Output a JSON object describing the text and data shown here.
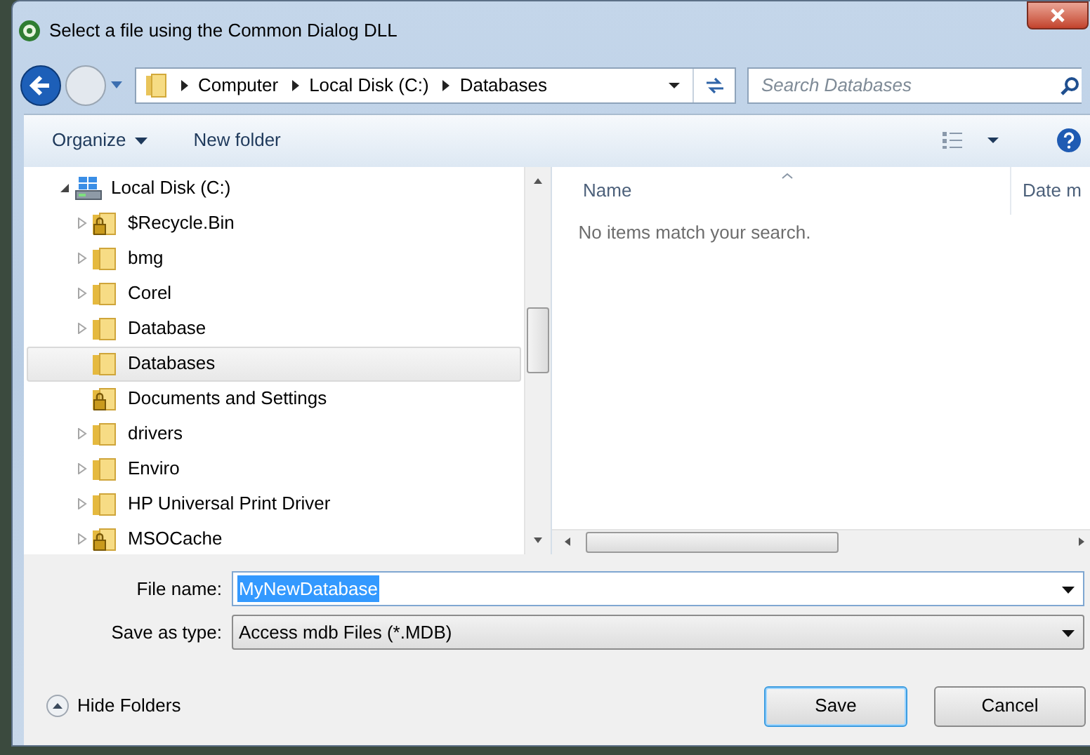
{
  "window": {
    "title": "Select a file using the Common Dialog DLL"
  },
  "address": {
    "breadcrumb": [
      "Computer",
      "Local Disk (C:)",
      "Databases"
    ]
  },
  "search": {
    "placeholder": "Search Databases"
  },
  "toolbar": {
    "organize": "Organize",
    "new_folder": "New folder"
  },
  "tree": [
    {
      "label": "Local Disk (C:)",
      "kind": "drive",
      "expanded": true,
      "selected": false,
      "children": [
        {
          "label": "$Recycle.Bin",
          "kind": "locked-folder",
          "expanded": false,
          "selected": false
        },
        {
          "label": "bmg",
          "kind": "folder",
          "expanded": false,
          "selected": false
        },
        {
          "label": "Corel",
          "kind": "folder",
          "expanded": false,
          "selected": false
        },
        {
          "label": "Database",
          "kind": "folder",
          "expanded": false,
          "selected": false
        },
        {
          "label": "Databases",
          "kind": "folder",
          "selected": true
        },
        {
          "label": "Documents and Settings",
          "kind": "locked-folder",
          "selected": false
        },
        {
          "label": "drivers",
          "kind": "folder",
          "expanded": false,
          "selected": false
        },
        {
          "label": "Enviro",
          "kind": "folder",
          "expanded": false,
          "selected": false
        },
        {
          "label": "HP Universal Print Driver",
          "kind": "folder",
          "expanded": false,
          "selected": false
        },
        {
          "label": "MSOCache",
          "kind": "locked-folder",
          "expanded": false,
          "selected": false
        }
      ]
    }
  ],
  "file_list": {
    "columns": [
      "Name",
      "Date m"
    ],
    "empty_message": "No items match your search."
  },
  "file_name": {
    "label": "File name:",
    "value": "MyNewDatabase",
    "value_selected": true
  },
  "save_as_type": {
    "label": "Save as type:",
    "value": "Access mdb Files (*.MDB)"
  },
  "hide_folders": "Hide Folders",
  "buttons": [
    {
      "label": "Save",
      "default": true
    },
    {
      "label": "Cancel",
      "default": false
    }
  ]
}
